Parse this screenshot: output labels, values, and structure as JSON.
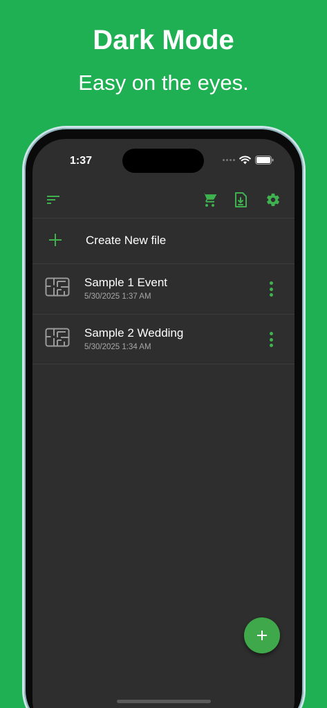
{
  "promo": {
    "title": "Dark Mode",
    "subtitle": "Easy on the eyes."
  },
  "status_bar": {
    "time": "1:37"
  },
  "toolbar": {
    "icons": [
      "sort-icon",
      "cart-icon",
      "import-file-icon",
      "gear-icon"
    ]
  },
  "create": {
    "label": "Create New file"
  },
  "files": [
    {
      "name": "Sample 1 Event",
      "date": "5/30/2025 1:37 AM"
    },
    {
      "name": "Sample 2 Wedding",
      "date": "5/30/2025 1:34 AM"
    }
  ],
  "colors": {
    "brand_green": "#1eb053",
    "accent_green": "#3fb24f",
    "background": "#2e2e2e"
  }
}
